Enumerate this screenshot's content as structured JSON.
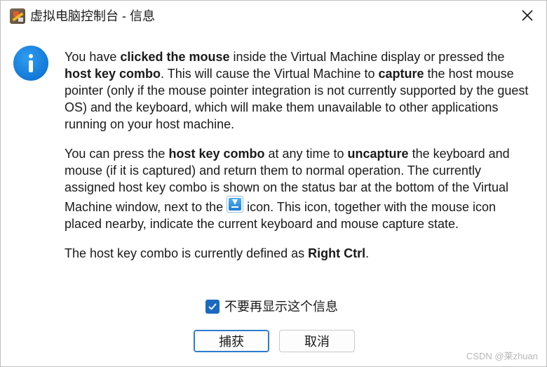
{
  "window": {
    "title": "虚拟电脑控制台 - 信息",
    "app_icon": "virtualbox-app-icon",
    "close_icon": "close-icon"
  },
  "message": {
    "icon": "info-icon",
    "p1": {
      "t1": "You have ",
      "b1": "clicked the mouse",
      "t2": " inside the Virtual Machine display or pressed the ",
      "b2": "host key combo",
      "t3": ". This will cause the Virtual Machine to ",
      "b3": "capture",
      "t4": " the host mouse pointer (only if the mouse pointer integration is not currently supported by the guest OS) and the keyboard, which will make them unavailable to other applications running on your host machine."
    },
    "p2": {
      "t1": "You can press the ",
      "b1": "host key combo",
      "t2": " at any time to ",
      "b2": "uncapture",
      "t3": " the keyboard and mouse (if it is captured) and return them to normal operation. The currently assigned host key combo is shown on the status bar at the bottom of the Virtual Machine window, next to the ",
      "inline_icon": "host-key-icon",
      "t4": " icon. This icon, together with the mouse icon placed nearby, indicate the current keyboard and mouse capture state."
    },
    "p3": {
      "t1": "The host key combo is currently defined as ",
      "b1": "Right Ctrl",
      "t2": "."
    }
  },
  "checkbox": {
    "label": "不要再显示这个信息",
    "checked": true
  },
  "buttons": {
    "capture": "捕获",
    "cancel": "取消"
  },
  "watermark": "CSDN @莱zhuan",
  "colors": {
    "accent": "#1b6ac0",
    "info_icon": "#1279d8",
    "primary_border": "#2f7bd0"
  }
}
